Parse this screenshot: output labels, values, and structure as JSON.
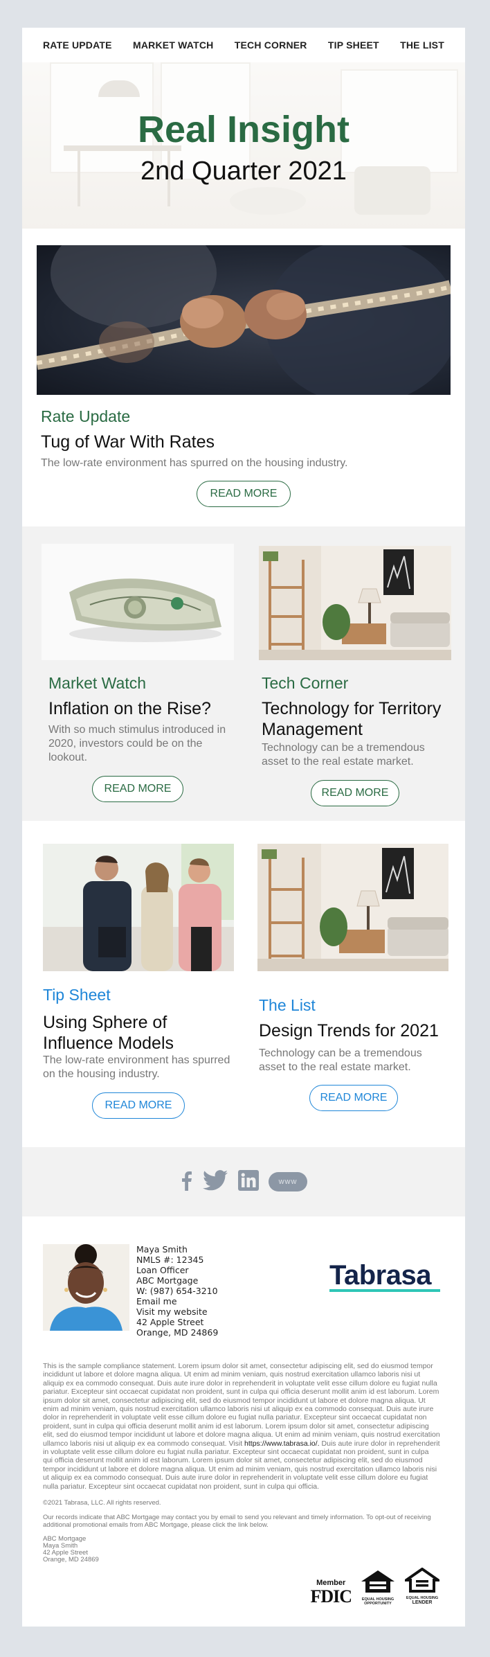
{
  "nav": {
    "items": [
      {
        "label": "RATE UPDATE"
      },
      {
        "label": "MARKET WATCH"
      },
      {
        "label": "TECH CORNER"
      },
      {
        "label": "TIP SHEET"
      },
      {
        "label": "THE LIST"
      }
    ]
  },
  "hero": {
    "title": "Real Insight",
    "subtitle": "2nd Quarter 2021"
  },
  "rate_update": {
    "kicker": "Rate Update",
    "headline": "Tug of War With Rates",
    "description": "The low-rate environment has spurred on the housing industry.",
    "button": "READ MORE"
  },
  "market_watch": {
    "kicker": "Market Watch",
    "headline": "Inflation on the Rise?",
    "description": "With so much stimulus introduced in 2020, investors could be on the lookout.",
    "button": "READ MORE"
  },
  "tech_corner": {
    "kicker": "Tech Corner",
    "headline": "Technology for Territory Management",
    "description": "Technology can be a tremendous asset to the real estate market.",
    "button": "READ MORE"
  },
  "tip_sheet": {
    "kicker": "Tip Sheet",
    "headline": "Using Sphere of Influence Models",
    "description": "The low-rate environment has spurred on the housing industry.",
    "button": "READ MORE"
  },
  "the_list": {
    "kicker": "The List",
    "headline": "Design Trends for 2021",
    "description": "Technology can be a tremendous asset to the real estate market.",
    "button": "READ MORE"
  },
  "social": {
    "icons": [
      "facebook-icon",
      "twitter-icon",
      "linkedin-icon",
      "website-icon"
    ],
    "www_label": "www"
  },
  "signature": {
    "name": "Maya Smith",
    "nmls": "NMLS #: 12345",
    "title": "Loan Officer",
    "company": "ABC Mortgage",
    "phone": "W: (987) 654-3210",
    "email_link": "Email me",
    "website_link": "Visit my website",
    "address1": "42 Apple Street",
    "address2": "Orange, MD 24869"
  },
  "brand": {
    "logo": "Tabrasa",
    "logo_color": "#14244a",
    "underline_color": "#2fc6b7"
  },
  "legal": {
    "compliance_before_link": "This is the sample compliance statement. Lorem ipsum dolor sit amet, consectetur adipiscing elit, sed do eiusmod tempor incididunt ut labore et dolore magna aliqua. Ut enim ad minim veniam, quis nostrud exercitation ullamco laboris nisi ut aliquip ex ea commodo consequat. Duis aute irure dolor in reprehenderit in voluptate velit esse cillum dolore eu fugiat nulla pariatur. Excepteur sint occaecat cupidatat non proident, sunt in culpa qui officia deserunt mollit anim id est laborum. Lorem ipsum dolor sit amet, consectetur adipiscing elit, sed do eiusmod tempor incididunt ut labore et dolore magna aliqua. Ut enim ad minim veniam, quis nostrud exercitation ullamco laboris nisi ut aliquip ex ea commodo consequat. Duis aute irure dolor in reprehenderit in voluptate velit esse cillum dolore eu fugiat nulla pariatur. Excepteur sint occaecat cupidatat non proident, sunt in culpa qui officia deserunt mollit anim id est laborum. Lorem ipsum dolor sit amet, consectetur adipiscing elit, sed do eiusmod tempor incididunt ut labore et dolore magna aliqua. Ut enim ad minim veniam, quis nostrud exercitation ullamco laboris nisi ut aliquip ex ea commodo consequat. Visit ",
    "compliance_link": "https://www.tabrasa.io/.",
    "compliance_after_link": " Duis aute irure dolor in reprehenderit in voluptate velit esse cillum dolore eu fugiat nulla pariatur. Excepteur sint occaecat cupidatat non proident, sunt in culpa qui officia deserunt mollit anim id est laborum. Lorem ipsum dolor sit amet, consectetur adipiscing elit, sed do eiusmod tempor incididunt ut labore et dolore magna aliqua. Ut enim ad minim veniam, quis nostrud exercitation ullamco laboris nisi ut aliquip ex ea commodo consequat. Duis aute irure dolor in reprehenderit in voluptate velit esse cillum dolore eu fugiat nulla pariatur. Excepteur sint occaecat cupidatat non proident, sunt in culpa qui officia.",
    "copyright": "©2021 Tabrasa, LLC. All rights reserved.",
    "optout": "Our records indicate that ABC Mortgage may contact you by email to send you relevant and timely information. To opt-out of receiving additional promotional emails from ABC Mortgage, please click the link below.",
    "address_lines": [
      "ABC Mortgage",
      "Maya Smith",
      "42 Apple Street",
      "Orange, MD 24869"
    ]
  },
  "badges": {
    "fdic_top": "Member",
    "fdic_main": "FDIC",
    "eho1_a": "EQUAL HOUSING",
    "eho1_b": "OPPORTUNITY",
    "eho2_a": "EQUAL HOUSING",
    "eho2_b": "LENDER"
  },
  "colors": {
    "green": "#2a6b43",
    "blue": "#1f86d8",
    "page_bg": "#dfe3e8",
    "band_grey": "#f2f2f2"
  }
}
